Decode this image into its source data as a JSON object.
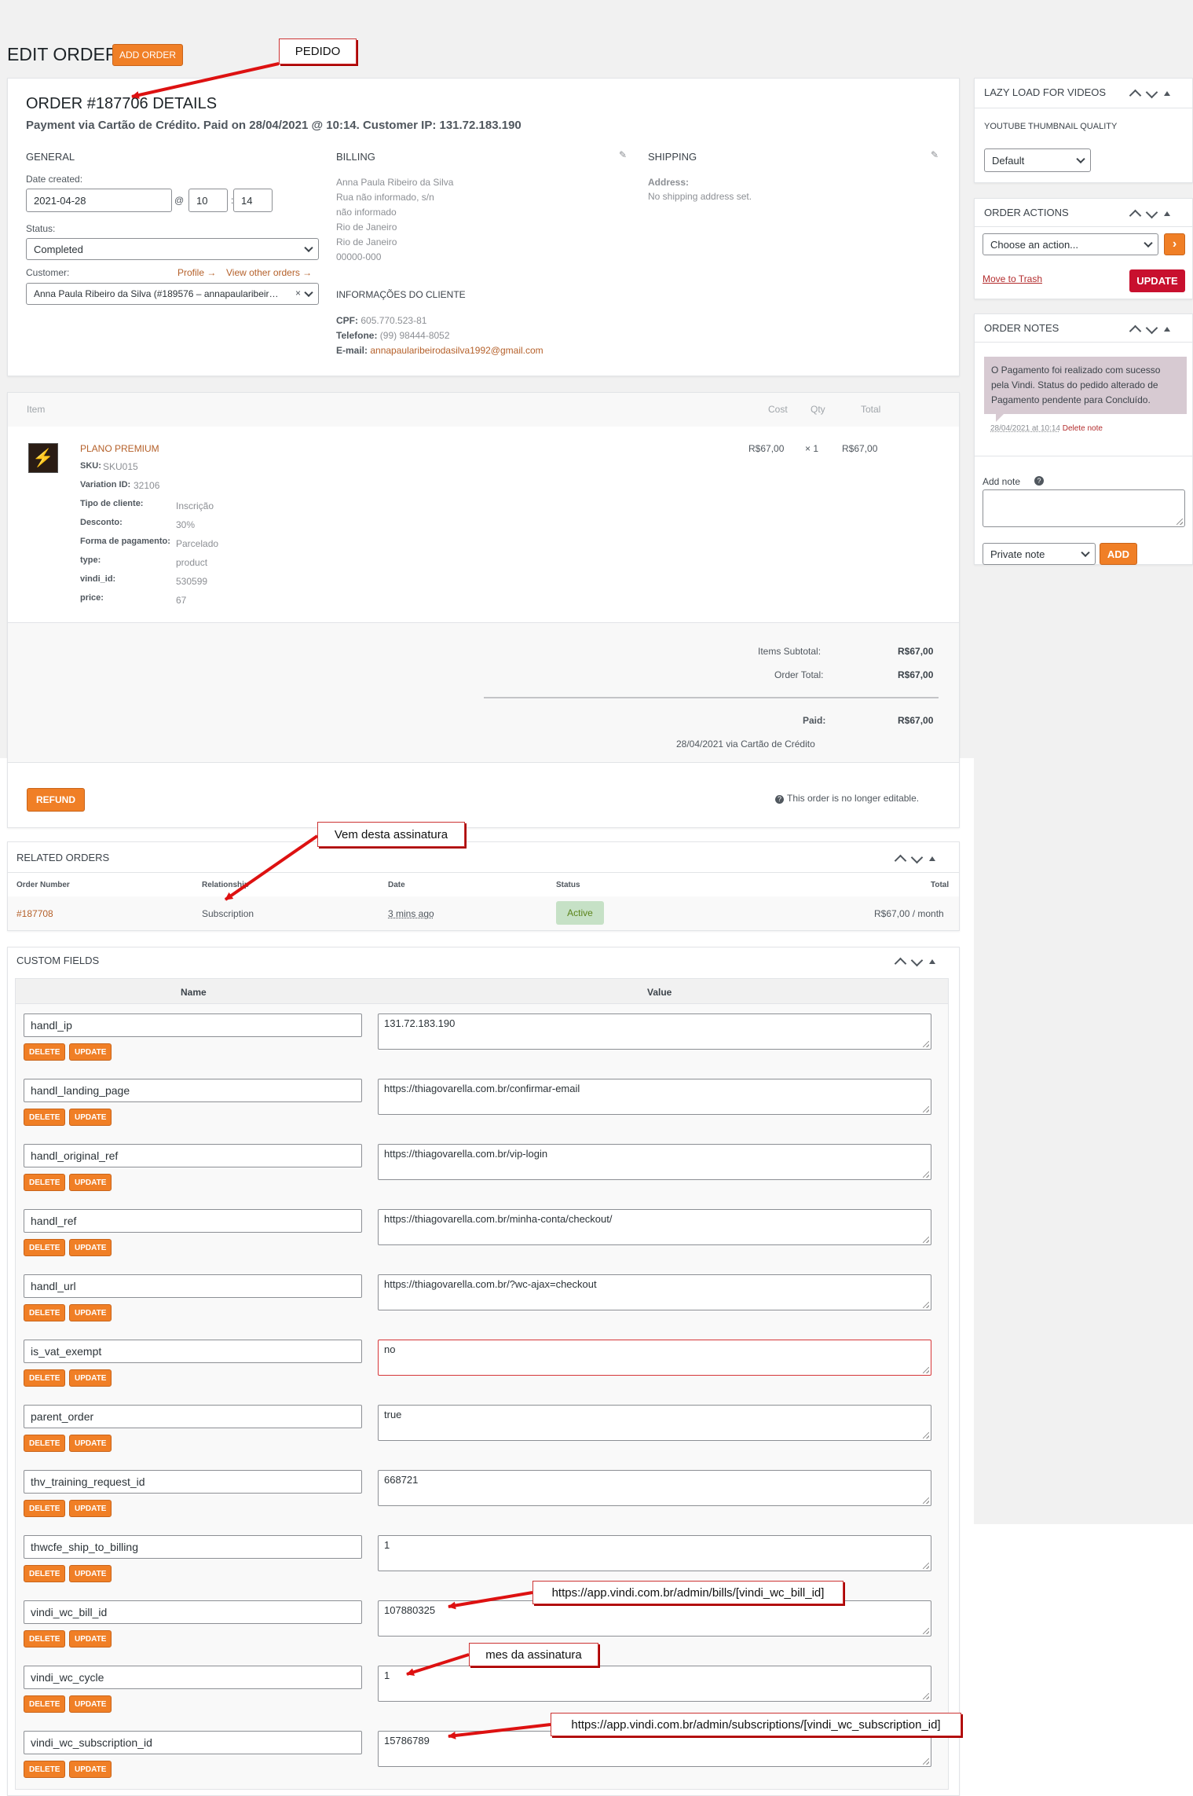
{
  "page": {
    "title": "EDIT ORDER",
    "add_order": "ADD ORDER"
  },
  "annotations": {
    "pedido": "PEDIDO",
    "vem": "Vem desta assinatura",
    "bill_url": "https://app.vindi.com.br/admin/bills/[vindi_wc_bill_id]",
    "mes": "mes da assinatura",
    "sub_url": "https://app.vindi.com.br/admin/subscriptions/[vindi_wc_subscription_id]"
  },
  "order": {
    "heading": "ORDER #187706 DETAILS",
    "subheading": "Payment via Cartão de Crédito. Paid on 28/04/2021 @ 10:14. Customer IP: 131.72.183.190",
    "general": {
      "title": "GENERAL",
      "date_label": "Date created:",
      "date": "2021-04-28",
      "at": "@",
      "hour": "10",
      "colon": ":",
      "minute": "14",
      "status_label": "Status:",
      "status": "Completed",
      "customer_label": "Customer:",
      "profile_link": "Profile →",
      "other_orders_link": "View other orders →",
      "customer": "Anna Paula Ribeiro da Silva (#189576 – annapaularibeir…",
      "clear": "×"
    },
    "billing": {
      "title": "BILLING",
      "lines": [
        "Anna Paula Ribeiro da Silva",
        "Rua não informado, s/n",
        "não informado",
        "Rio de Janeiro",
        "Rio de Janeiro",
        "00000-000"
      ],
      "client_info_title": "INFORMAÇÕES DO CLIENTE",
      "cpf_label": "CPF:",
      "cpf": "605.770.523-81",
      "phone_label": "Telefone:",
      "phone": "(99) 98444-8052",
      "email_label": "E-mail:",
      "email": "annapaularibeirodasilva1992@gmail.com"
    },
    "shipping": {
      "title": "SHIPPING",
      "address_label": "Address:",
      "address": "No shipping address set."
    }
  },
  "items": {
    "headers": {
      "item": "Item",
      "cost": "Cost",
      "qty": "Qty",
      "total": "Total"
    },
    "product": {
      "name": "PLANO PREMIUM",
      "cost": "R$67,00",
      "qty": "× 1",
      "total": "R$67,00",
      "meta": [
        {
          "k": "SKU:",
          "v": "SKU015"
        },
        {
          "k": "Variation ID:",
          "v": "32106"
        },
        {
          "k": "Tipo de cliente:",
          "v": "Inscrição"
        },
        {
          "k": "Desconto:",
          "v": "30%"
        },
        {
          "k": "Forma de pagamento:",
          "v": "Parcelado"
        },
        {
          "k": "type:",
          "v": "product"
        },
        {
          "k": "vindi_id:",
          "v": "530599"
        },
        {
          "k": "price:",
          "v": "67"
        }
      ]
    },
    "totals": {
      "subtotal_label": "Items Subtotal:",
      "subtotal": "R$67,00",
      "total_label": "Order Total:",
      "total": "R$67,00",
      "paid_label": "Paid:",
      "paid": "R$67,00",
      "paid_note": "28/04/2021 via Cartão de Crédito"
    },
    "refund": "REFUND",
    "not_editable": "This order is no longer editable."
  },
  "related": {
    "title": "RELATED ORDERS",
    "headers": {
      "number": "Order Number",
      "relationship": "Relationship",
      "date": "Date",
      "status": "Status",
      "total": "Total"
    },
    "row": {
      "number": "#187708",
      "relationship": "Subscription",
      "date": "3 mins ago",
      "status": "Active",
      "total": "R$67,00 / month"
    }
  },
  "custom_fields": {
    "title": "CUSTOM FIELDS",
    "name_header": "Name",
    "value_header": "Value",
    "delete": "DELETE",
    "update": "UPDATE",
    "rows": [
      {
        "name": "handl_ip",
        "value": "131.72.183.190"
      },
      {
        "name": "handl_landing_page",
        "value": "https://thiagovarella.com.br/confirmar-email"
      },
      {
        "name": "handl_original_ref",
        "value": "https://thiagovarella.com.br/vip-login"
      },
      {
        "name": "handl_ref",
        "value": "https://thiagovarella.com.br/minha-conta/checkout/"
      },
      {
        "name": "handl_url",
        "value": "https://thiagovarella.com.br/?wc-ajax=checkout"
      },
      {
        "name": "is_vat_exempt",
        "value": "no"
      },
      {
        "name": "parent_order",
        "value": "true"
      },
      {
        "name": "thv_training_request_id",
        "value": "668721"
      },
      {
        "name": "thwcfe_ship_to_billing",
        "value": "1"
      },
      {
        "name": "vindi_wc_bill_id",
        "value": "107880325"
      },
      {
        "name": "vindi_wc_cycle",
        "value": "1"
      },
      {
        "name": "vindi_wc_subscription_id",
        "value": "15786789"
      }
    ]
  },
  "sidebar": {
    "lazy": {
      "title": "LAZY LOAD FOR VIDEOS",
      "quality_label": "YOUTUBE THUMBNAIL QUALITY",
      "quality": "Default"
    },
    "actions": {
      "title": "ORDER ACTIONS",
      "choose": "Choose an action...",
      "go": "›",
      "trash": "Move to Trash",
      "update": "UPDATE"
    },
    "notes": {
      "title": "ORDER NOTES",
      "note": "O Pagamento foi realizado com sucesso pela Vindi. Status do pedido alterado de Pagamento pendente para Concluído.",
      "note_date": "28/04/2021 at 10:14",
      "delete_note": "Delete note",
      "add_note_label": "Add note",
      "help": "?",
      "note_type": "Private note",
      "add": "ADD"
    }
  },
  "colors": {
    "accent": "#f07f26",
    "update_red": "#c8102e",
    "link": "#b5612b",
    "active_bg": "#c6e1c6"
  }
}
